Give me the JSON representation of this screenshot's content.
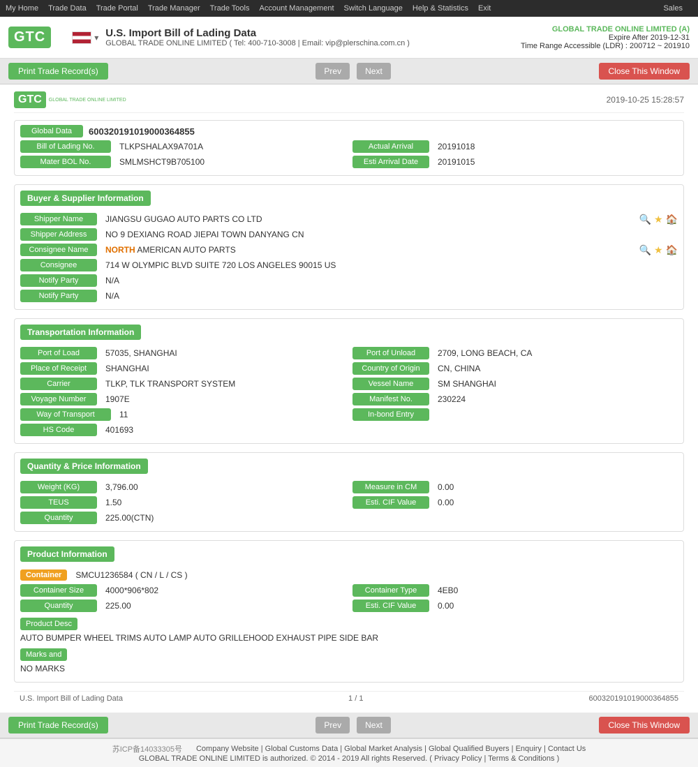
{
  "topnav": {
    "items": [
      "My Home",
      "Trade Data",
      "Trade Portal",
      "Trade Manager",
      "Trade Tools",
      "Account Management",
      "Switch Language",
      "Help & Statistics",
      "Exit"
    ],
    "sales": "Sales"
  },
  "header": {
    "logo_text": "GTC",
    "logo_sub": "GLOBAL TRADE ONLINE LIMITED",
    "flag_alt": "US Flag",
    "title": "U.S. Import Bill of Lading Data",
    "subtitle": "GLOBAL TRADE ONLINE LIMITED ( Tel: 400-710-3008 | Email: vip@plerschina.com.cn )",
    "company": "GLOBAL TRADE ONLINE LIMITED (A)",
    "expire": "Expire After 2019-12-31",
    "time_range": "Time Range Accessible (LDR) : 200712 ~ 201910"
  },
  "toolbar": {
    "print_btn": "Print Trade Record(s)",
    "prev_btn": "Prev",
    "next_btn": "Next",
    "close_btn": "Close This Window"
  },
  "doc": {
    "timestamp": "2019-10-25 15:28:57",
    "global_label": "Global Data",
    "global_value": "600320191019000364855",
    "bill_of_lading_label": "Bill of Lading No.",
    "bill_of_lading_value": "TLKPSHALAX9A701A",
    "actual_arrival_label": "Actual Arrival",
    "actual_arrival_value": "20191018",
    "mater_bol_label": "Mater BOL No.",
    "mater_bol_value": "SMLMSHCT9B705100",
    "esti_arrival_label": "Esti Arrival Date",
    "esti_arrival_value": "20191015",
    "buyer_supplier_title": "Buyer & Supplier Information",
    "shipper_name_label": "Shipper Name",
    "shipper_name_value": "JIANGSU GUGAO AUTO PARTS CO LTD",
    "shipper_address_label": "Shipper Address",
    "shipper_address_value": "NO 9 DEXIANG ROAD JIEPAI TOWN DANYANG CN",
    "consignee_name_label": "Consignee Name",
    "consignee_name_value_highlight": "NORTH",
    "consignee_name_value_rest": " AMERICAN AUTO PARTS",
    "consignee_label": "Consignee",
    "consignee_value": "714 W OLYMPIC BLVD SUITE 720 LOS ANGELES 90015 US",
    "notify_party1_label": "Notify Party",
    "notify_party1_value": "N/A",
    "notify_party2_label": "Notify Party",
    "notify_party2_value": "N/A",
    "transport_title": "Transportation Information",
    "port_load_label": "Port of Load",
    "port_load_value": "57035, SHANGHAI",
    "port_unload_label": "Port of Unload",
    "port_unload_value": "2709, LONG BEACH, CA",
    "place_receipt_label": "Place of Receipt",
    "place_receipt_value": "SHANGHAI",
    "country_origin_label": "Country of Origin",
    "country_origin_value": "CN, CHINA",
    "carrier_label": "Carrier",
    "carrier_value": "TLKP, TLK TRANSPORT SYSTEM",
    "vessel_name_label": "Vessel Name",
    "vessel_name_value": "SM SHANGHAI",
    "voyage_number_label": "Voyage Number",
    "voyage_number_value": "1907E",
    "manifest_no_label": "Manifest No.",
    "manifest_no_value": "230224",
    "way_transport_label": "Way of Transport",
    "way_transport_value": "11",
    "inbond_label": "In-bond Entry",
    "inbond_value": "",
    "hs_code_label": "HS Code",
    "hs_code_value": "401693",
    "quantity_price_title": "Quantity & Price Information",
    "weight_label": "Weight (KG)",
    "weight_value": "3,796.00",
    "measure_label": "Measure in CM",
    "measure_value": "0.00",
    "teus_label": "TEUS",
    "teus_value": "1.50",
    "esti_cif_label": "Esti. CIF Value",
    "esti_cif_value": "0.00",
    "quantity_label": "Quantity",
    "quantity_value": "225.00(CTN)",
    "product_title": "Product Information",
    "container_label": "Container",
    "container_value": "SMCU1236584 ( CN / L / CS )",
    "container_size_label": "Container Size",
    "container_size_value": "4000*906*802",
    "container_type_label": "Container Type",
    "container_type_value": "4EB0",
    "product_quantity_label": "Quantity",
    "product_quantity_value": "225.00",
    "product_esti_cif_label": "Esti. CIF Value",
    "product_esti_cif_value": "0.00",
    "product_desc_label": "Product Desc",
    "product_desc_value": "AUTO BUMPER WHEEL TRIMS AUTO LAMP AUTO GRILLEHOOD EXHAUST PIPE SIDE BAR",
    "marks_label": "Marks and",
    "marks_value": "NO MARKS",
    "footer_left": "U.S. Import Bill of Lading Data",
    "footer_mid": "1 / 1",
    "footer_right": "600320191019000364855"
  },
  "page_footer": {
    "links": [
      "Company Website",
      "Global Customs Data",
      "Global Market Analysis",
      "Global Qualified Buyers",
      "Enquiry",
      "Contact Us"
    ],
    "copyright": "GLOBAL TRADE ONLINE LIMITED is authorized. © 2014 - 2019 All rights Reserved.  (  Privacy Policy  |  Terms & Conditions  )",
    "icp": "苏ICP备14033305号"
  }
}
